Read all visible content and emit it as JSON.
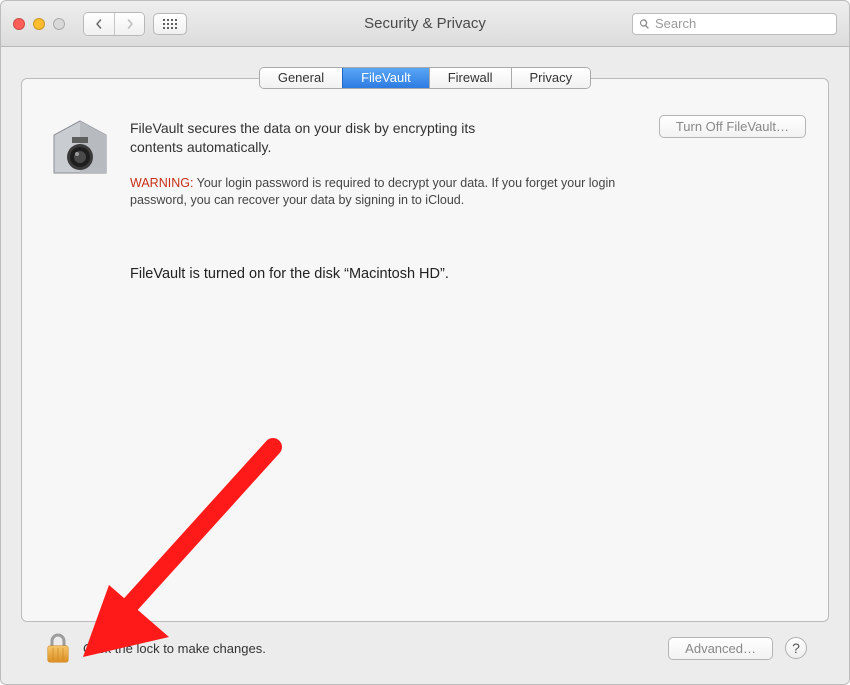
{
  "window": {
    "title": "Security & Privacy"
  },
  "search": {
    "placeholder": "Search"
  },
  "tabs": [
    {
      "label": "General",
      "active": false
    },
    {
      "label": "FileVault",
      "active": true
    },
    {
      "label": "Firewall",
      "active": false
    },
    {
      "label": "Privacy",
      "active": false
    }
  ],
  "filevault": {
    "description": "FileVault secures the data on your disk by encrypting its contents automatically.",
    "warning_label": "WARNING:",
    "warning_text": " Your login password is required to decrypt your data. If you forget your login password, you can recover your data by signing in to iCloud.",
    "turn_off_label": "Turn Off FileVault…",
    "status": "FileVault is turned on for the disk “Macintosh HD”."
  },
  "footer": {
    "lock_text": "Click the lock to make changes.",
    "advanced_label": "Advanced…",
    "help_label": "?"
  }
}
